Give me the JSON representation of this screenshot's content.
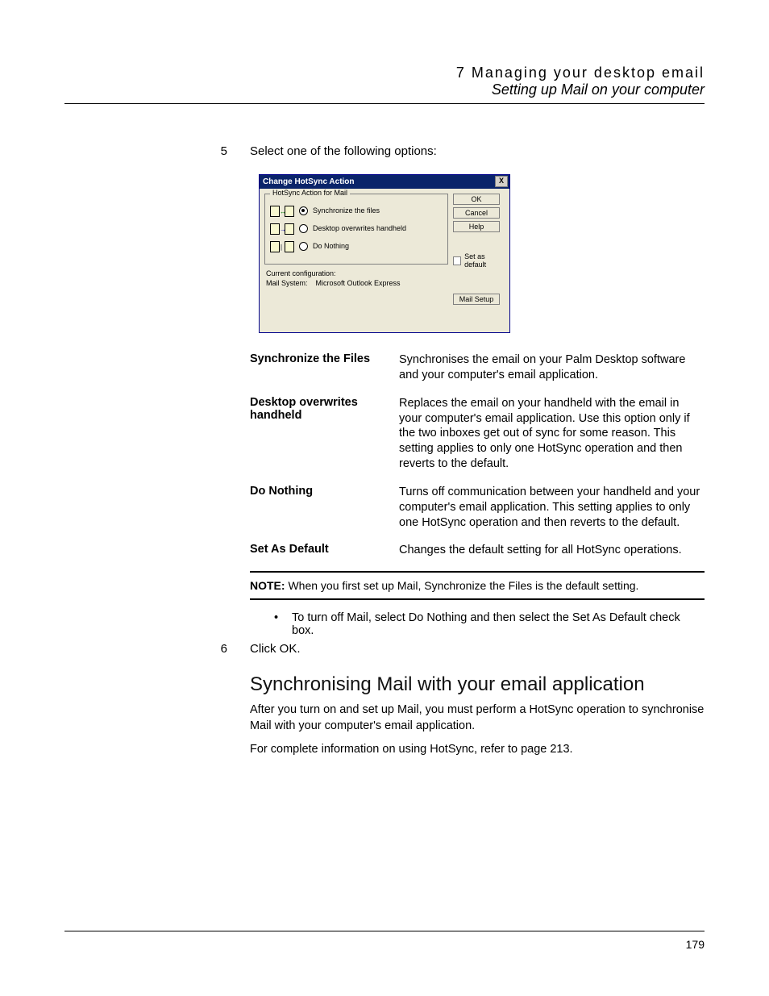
{
  "header": {
    "chapter": "7 Managing your desktop email",
    "section": "Setting up Mail on your computer"
  },
  "steps": {
    "s5": {
      "num": "5",
      "text": "Select one of the following options:"
    },
    "s6": {
      "num": "6",
      "text": "Click OK."
    }
  },
  "dialog": {
    "title": "Change HotSync Action",
    "close": "X",
    "group": "HotSync Action for Mail",
    "opt1": "Synchronize the files",
    "opt2": "Desktop overwrites handheld",
    "opt3": "Do Nothing",
    "current_cfg": "Current configuration:",
    "mail_system_label": "Mail System:",
    "mail_system_value": "Microsoft Outlook Express",
    "btn_ok": "OK",
    "btn_cancel": "Cancel",
    "btn_help": "Help",
    "chk_default": "Set as default",
    "btn_mailsetup": "Mail Setup"
  },
  "defs": {
    "t1": "Synchronize the Files",
    "d1": "Synchronises the email on your Palm Desktop software and your computer's email application.",
    "t2": "Desktop overwrites handheld",
    "d2": "Replaces the email on your handheld with the email in your computer's email application. Use this option only if the two inboxes get out of sync for some reason. This setting applies to only one HotSync operation and then reverts to the default.",
    "t3": "Do Nothing",
    "d3": "Turns off communication between your handheld and your computer's email application. This setting applies to only one HotSync operation and then reverts to the default.",
    "t4": "Set As Default",
    "d4": "Changes the default setting for all HotSync operations."
  },
  "note": {
    "label": "NOTE:",
    "text": "When you first set up Mail, Synchronize the Files is the default setting."
  },
  "bullet": {
    "dot": "•",
    "text": "To turn off Mail, select Do Nothing and then select the Set As Default check box."
  },
  "subsection": {
    "title": "Synchronising Mail with your email application",
    "p1": "After you turn on and set up Mail, you must perform a HotSync operation to synchronise Mail with your computer's email application.",
    "p2": "For complete information on using HotSync, refer to page 213."
  },
  "page_number": "179"
}
